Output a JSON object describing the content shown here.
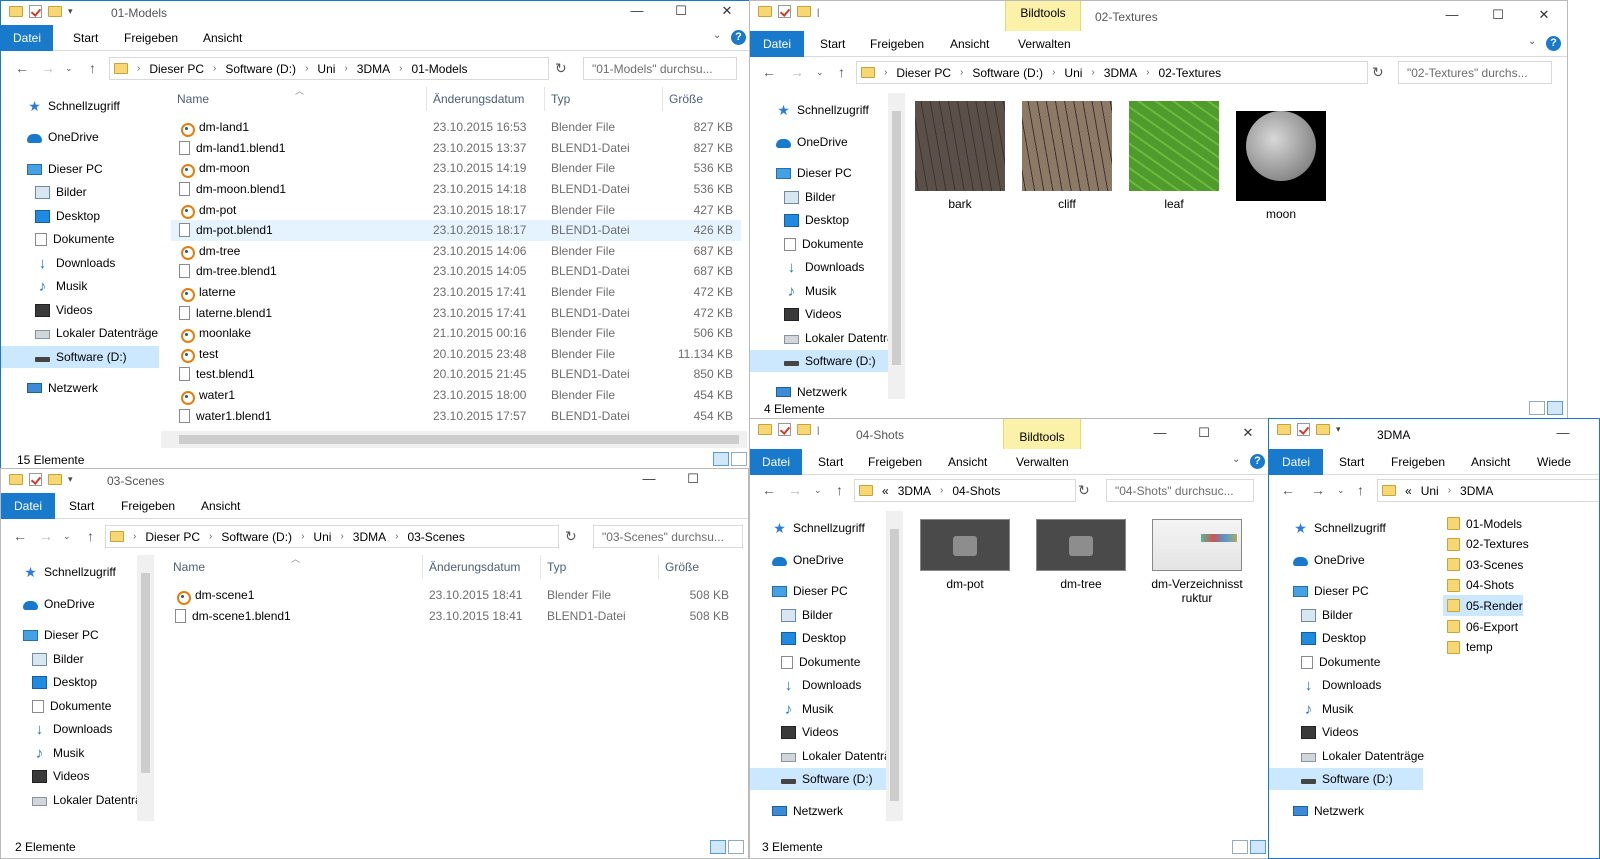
{
  "common": {
    "datei": "Datei",
    "start": "Start",
    "freigeben": "Freigeben",
    "ansicht": "Ansicht",
    "verwalten": "Verwalten",
    "bildtools": "Bildtools",
    "help": "?"
  },
  "nav": {
    "schnellzugriff": "Schnellzugriff",
    "onedrive": "OneDrive",
    "dieser_pc": "Dieser PC",
    "bilder": "Bilder",
    "desktop": "Desktop",
    "dokumente": "Dokumente",
    "downloads": "Downloads",
    "musik": "Musik",
    "videos": "Videos",
    "lokaler": "Lokaler Datenträger",
    "lokaler_short": "Lokaler Datenträ",
    "software": "Software (D:)",
    "netzwerk": "Netzwerk"
  },
  "w1": {
    "title": "01-Models",
    "path": [
      "Dieser PC",
      "Software (D:)",
      "Uni",
      "3DMA",
      "01-Models"
    ],
    "search": "\"01-Models\" durchsu...",
    "cols": [
      "Name",
      "Änderungsdatum",
      "Typ",
      "Größe"
    ],
    "status": "15 Elemente",
    "files": [
      {
        "name": "dm-land1",
        "date": "23.10.2015 16:53",
        "type": "Blender File",
        "size": "827 KB",
        "icon": "blender-icon"
      },
      {
        "name": "dm-land1.blend1",
        "date": "23.10.2015 13:37",
        "type": "BLEND1-Datei",
        "size": "827 KB",
        "icon": "file-icon"
      },
      {
        "name": "dm-moon",
        "date": "23.10.2015 14:19",
        "type": "Blender File",
        "size": "536 KB",
        "icon": "blender-icon"
      },
      {
        "name": "dm-moon.blend1",
        "date": "23.10.2015 14:18",
        "type": "BLEND1-Datei",
        "size": "536 KB",
        "icon": "file-icon"
      },
      {
        "name": "dm-pot",
        "date": "23.10.2015 18:17",
        "type": "Blender File",
        "size": "427 KB",
        "icon": "blender-icon"
      },
      {
        "name": "dm-pot.blend1",
        "date": "23.10.2015 18:17",
        "type": "BLEND1-Datei",
        "size": "426 KB",
        "icon": "file-icon",
        "selected": true
      },
      {
        "name": "dm-tree",
        "date": "23.10.2015 14:06",
        "type": "Blender File",
        "size": "687 KB",
        "icon": "blender-icon"
      },
      {
        "name": "dm-tree.blend1",
        "date": "23.10.2015 14:05",
        "type": "BLEND1-Datei",
        "size": "687 KB",
        "icon": "file-icon"
      },
      {
        "name": "laterne",
        "date": "23.10.2015 17:41",
        "type": "Blender File",
        "size": "472 KB",
        "icon": "blender-icon"
      },
      {
        "name": "laterne.blend1",
        "date": "23.10.2015 17:41",
        "type": "BLEND1-Datei",
        "size": "472 KB",
        "icon": "file-icon"
      },
      {
        "name": "moonlake",
        "date": "21.10.2015 00:16",
        "type": "Blender File",
        "size": "506 KB",
        "icon": "blender-icon"
      },
      {
        "name": "test",
        "date": "20.10.2015 23:48",
        "type": "Blender File",
        "size": "11.134 KB",
        "icon": "blender-icon"
      },
      {
        "name": "test.blend1",
        "date": "20.10.2015 21:45",
        "type": "BLEND1-Datei",
        "size": "850 KB",
        "icon": "file-icon"
      },
      {
        "name": "water1",
        "date": "23.10.2015 18:00",
        "type": "Blender File",
        "size": "454 KB",
        "icon": "blender-icon"
      },
      {
        "name": "water1.blend1",
        "date": "23.10.2015 17:57",
        "type": "BLEND1-Datei",
        "size": "454 KB",
        "icon": "file-icon"
      }
    ]
  },
  "w2": {
    "title": "02-Textures",
    "path": [
      "Dieser PC",
      "Software (D:)",
      "Uni",
      "3DMA",
      "02-Textures"
    ],
    "search": "\"02-Textures\" durchs...",
    "status": "4 Elemente",
    "tiles": [
      {
        "name": "bark",
        "color": "#5b4f49"
      },
      {
        "name": "cliff",
        "color": "#8d7a66"
      },
      {
        "name": "leaf",
        "color": "#4f9b2b"
      },
      {
        "name": "moon",
        "color": "#9a9a9a"
      }
    ]
  },
  "w3": {
    "title": "03-Scenes",
    "path": [
      "Dieser PC",
      "Software (D:)",
      "Uni",
      "3DMA",
      "03-Scenes"
    ],
    "search": "\"03-Scenes\" durchsu...",
    "cols": [
      "Name",
      "Änderungsdatum",
      "Typ",
      "Größe"
    ],
    "status": "2 Elemente",
    "files": [
      {
        "name": "dm-scene1",
        "date": "23.10.2015 18:41",
        "type": "Blender File",
        "size": "508 KB",
        "icon": "blender-icon"
      },
      {
        "name": "dm-scene1.blend1",
        "date": "23.10.2015 18:41",
        "type": "BLEND1-Datei",
        "size": "508 KB",
        "icon": "file-icon"
      }
    ]
  },
  "w4": {
    "title": "04-Shots",
    "path": [
      "«",
      "3DMA",
      "04-Shots"
    ],
    "search": "\"04-Shots\" durchsuc...",
    "status": "3 Elemente",
    "tiles": [
      {
        "name": "dm-pot",
        "line2": ""
      },
      {
        "name": "dm-tree",
        "line2": ""
      },
      {
        "name": "dm-Verzeichnisst",
        "line2": "ruktur"
      }
    ]
  },
  "w5": {
    "title": "3DMA",
    "path": [
      "«",
      "Uni",
      "3DMA"
    ],
    "wiede": "Wiede",
    "folders": [
      "01-Models",
      "02-Textures",
      "03-Scenes",
      "04-Shots",
      "05-Render",
      "06-Export",
      "temp"
    ],
    "selected_folder": "05-Render"
  }
}
